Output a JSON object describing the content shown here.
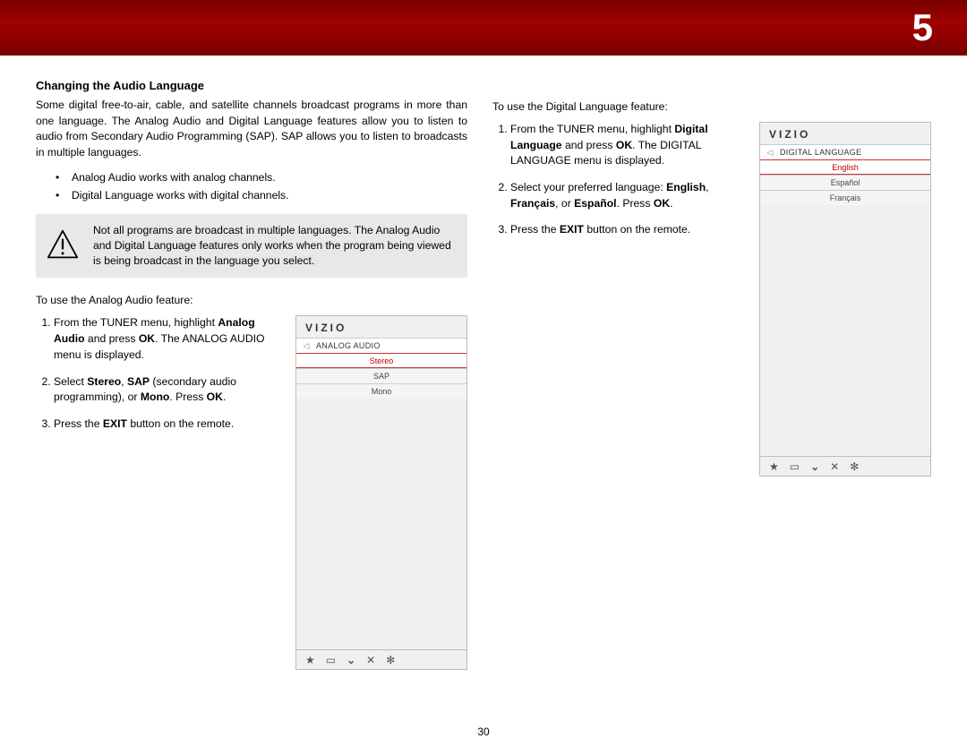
{
  "chapter": "5",
  "pageNumber": "30",
  "heading": "Changing the Audio Language",
  "intro": "Some digital free-to-air, cable, and satellite channels broadcast programs in more than one language. The Analog Audio and Digital Language features allow you to listen to audio from Secondary Audio Programming (SAP). SAP allows you to listen to broadcasts in multiple languages.",
  "bullets": [
    "Analog Audio works with analog channels.",
    "Digital Language works with digital channels."
  ],
  "note": "Not all programs are broadcast in multiple languages. The Analog Audio and Digital Language features only works when the program being viewed is being broadcast in the language you select.",
  "analog": {
    "lead": "To use the Analog Audio feature:",
    "step1a": "From the TUNER menu, highlight ",
    "step1b": "Analog Audio",
    "step1c": " and press ",
    "step1d": "OK",
    "step1e": ". The ANALOG AUDIO menu is displayed.",
    "step2a": "Select ",
    "step2b": "Stereo",
    "step2c": ", ",
    "step2d": "SAP",
    "step2e": " (secondary audio programming), or ",
    "step2f": "Mono",
    "step2g": ". Press ",
    "step2h": "OK",
    "step2i": ".",
    "step3a": "Press the ",
    "step3b": "EXIT",
    "step3c": " button on the remote."
  },
  "digital": {
    "lead": "To use the Digital Language feature:",
    "step1a": "From the TUNER menu, highlight ",
    "step1b": "Digital Language",
    "step1c": " and press ",
    "step1d": "OK",
    "step1e": ". The DIGITAL LANGUAGE menu is displayed.",
    "step2a": "Select your preferred language: ",
    "step2b": "English",
    "step2c": ", ",
    "step2d": "Français",
    "step2e": ", or ",
    "step2f": "Español",
    "step2g": ". Press ",
    "step2h": "OK",
    "step2i": ".",
    "step3a": "Press the ",
    "step3b": "EXIT",
    "step3c": " button on the remote."
  },
  "osd": {
    "brand": "VIZIO",
    "back": "◁",
    "analogTitle": "ANALOG AUDIO",
    "analogItems": [
      "Stereo",
      "SAP",
      "Mono"
    ],
    "digitalTitle": "DIGITAL LANGUAGE",
    "digitalItems": [
      "English",
      "Español",
      "Français"
    ],
    "footerIcons": {
      "star": "★",
      "cc": "▭",
      "v": "⌄",
      "x": "✕",
      "gear": "✻"
    }
  }
}
